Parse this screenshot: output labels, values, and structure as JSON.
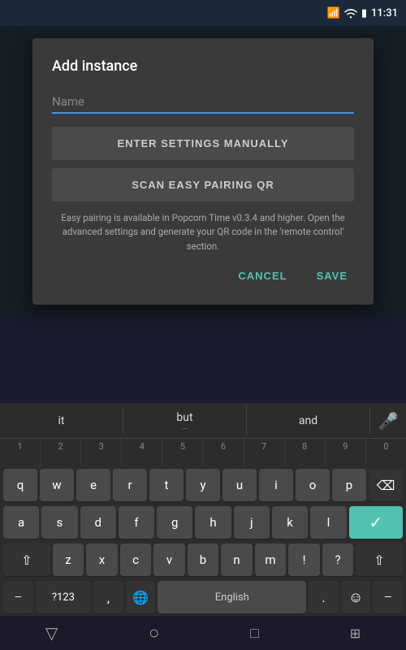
{
  "statusBar": {
    "time": "11:31",
    "bluetoothIcon": "bluetooth",
    "wifiIcon": "wifi",
    "batteryIcon": "battery"
  },
  "dialog": {
    "title": "Add instance",
    "namePlaceholder": "Name",
    "enterSettingsBtn": "ENTER SETTINGS MANUALLY",
    "scanQrBtn": "SCAN EASY PAIRING QR",
    "infoText": "Easy pairing is available in Popcorn Time v0.3.4 and higher. Open the advanced settings and generate your QR code in the 'remote control' section.",
    "cancelBtn": "CANCEL",
    "saveBtn": "SAVE"
  },
  "suggestions": [
    {
      "word": "it",
      "dots": ""
    },
    {
      "word": "but",
      "dots": "..."
    },
    {
      "word": "and",
      "dots": ""
    }
  ],
  "keyboard": {
    "row1": [
      "q",
      "w",
      "e",
      "r",
      "t",
      "y",
      "u",
      "i",
      "o",
      "p"
    ],
    "row2": [
      "a",
      "s",
      "d",
      "f",
      "g",
      "h",
      "j",
      "k",
      "l"
    ],
    "row3": [
      "z",
      "x",
      "c",
      "v",
      "b",
      "n",
      "m"
    ],
    "numbers": [
      "1",
      "2",
      "3",
      "4",
      "5",
      "6",
      "7",
      "8",
      "9",
      "0"
    ],
    "spaceLabel": "English",
    "symbolsLabel": "?123",
    "commaLabel": ",",
    "periodLabel": ".",
    "emojiLabel": "☺"
  },
  "navBar": {
    "backLabel": "▽",
    "homeLabel": "○",
    "recentLabel": "□",
    "keyboardLabel": "⊞"
  },
  "colors": {
    "accent": "#4fc3b0",
    "inputUnderline": "#4a90d9",
    "dialogBg": "#3a3a3a",
    "keyboardBg": "#2c2c2c",
    "keyBg": "#4a4a4a",
    "darkKeyBg": "#333333"
  }
}
